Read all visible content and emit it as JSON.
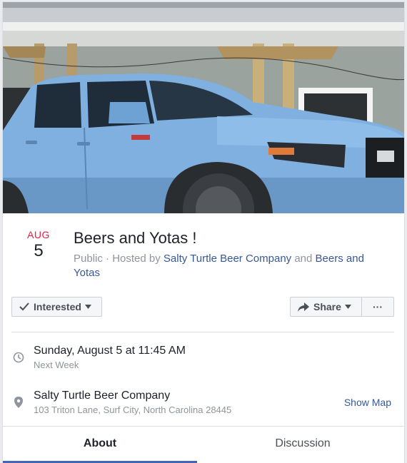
{
  "event": {
    "month": "AUG",
    "day": "5",
    "title": "Beers and Yotas !",
    "privacy": "Public",
    "hosted_by_prefix": "Hosted by",
    "host_1": "Salty Turtle Beer Company",
    "and_word": "and",
    "host_2": "Beers and Yotas",
    "separator": "·"
  },
  "actions": {
    "interested_label": "Interested",
    "share_label": "Share",
    "more_label": "···"
  },
  "details": {
    "datetime": "Sunday, August 5 at 11:45 AM",
    "relative_time": "Next Week",
    "location_name": "Salty Turtle Beer Company",
    "address": "103 Triton Lane, Surf City, North Carolina 28445",
    "show_map_label": "Show Map"
  },
  "tabs": [
    {
      "label": "About",
      "active": true
    },
    {
      "label": "Discussion",
      "active": false
    }
  ],
  "colors": {
    "month_red": "#e41e3f",
    "link_blue": "#365899",
    "tab_underline": "#4267b2",
    "truck_blue": "#7fb0e0"
  },
  "icons": {
    "interested": "checkmark-icon",
    "dropdown": "caret-down-icon",
    "share": "share-arrow-icon",
    "time": "clock-icon",
    "location": "map-pin-icon"
  }
}
